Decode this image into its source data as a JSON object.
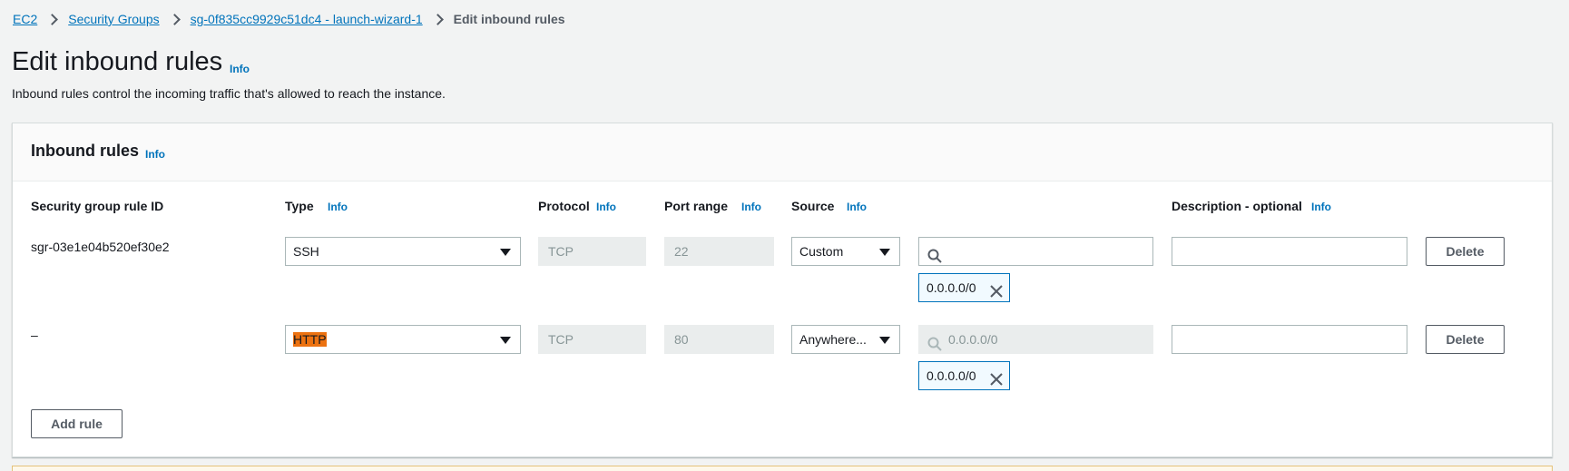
{
  "breadcrumb": {
    "items": [
      "EC2",
      "Security Groups",
      "sg-0f835cc9929c51dc4 - launch-wizard-1"
    ],
    "current": "Edit inbound rules"
  },
  "page": {
    "title": "Edit inbound rules",
    "info": "Info",
    "description": "Inbound rules control the incoming traffic that's allowed to reach the instance."
  },
  "panel": {
    "title": "Inbound rules",
    "info": "Info",
    "columns": {
      "rule_id": "Security group rule ID",
      "type": "Type",
      "protocol": "Protocol",
      "port_range": "Port range",
      "source": "Source",
      "description": "Description - optional",
      "info": "Info"
    },
    "rows": [
      {
        "rule_id": "sgr-03e1e04b520ef30e2",
        "type": "SSH",
        "protocol": "TCP",
        "port_range": "22",
        "source": "Custom",
        "search_value": "",
        "search_placeholder": "",
        "token": "0.0.0.0/0",
        "description": "",
        "delete_label": "Delete"
      },
      {
        "rule_id": "–",
        "type": "HTTP",
        "protocol": "TCP",
        "port_range": "80",
        "source": "Anywhere...",
        "search_value": "0.0.0.0/0",
        "token": "0.0.0.0/0",
        "description": "",
        "delete_label": "Delete"
      }
    ],
    "add_rule_label": "Add rule"
  },
  "colors": {
    "link": "#0073bb",
    "highlight": "#ec7211",
    "border": "#aab7b8"
  },
  "icons": [
    "chevron-right-icon",
    "caret-down-icon",
    "search-icon",
    "close-icon"
  ]
}
